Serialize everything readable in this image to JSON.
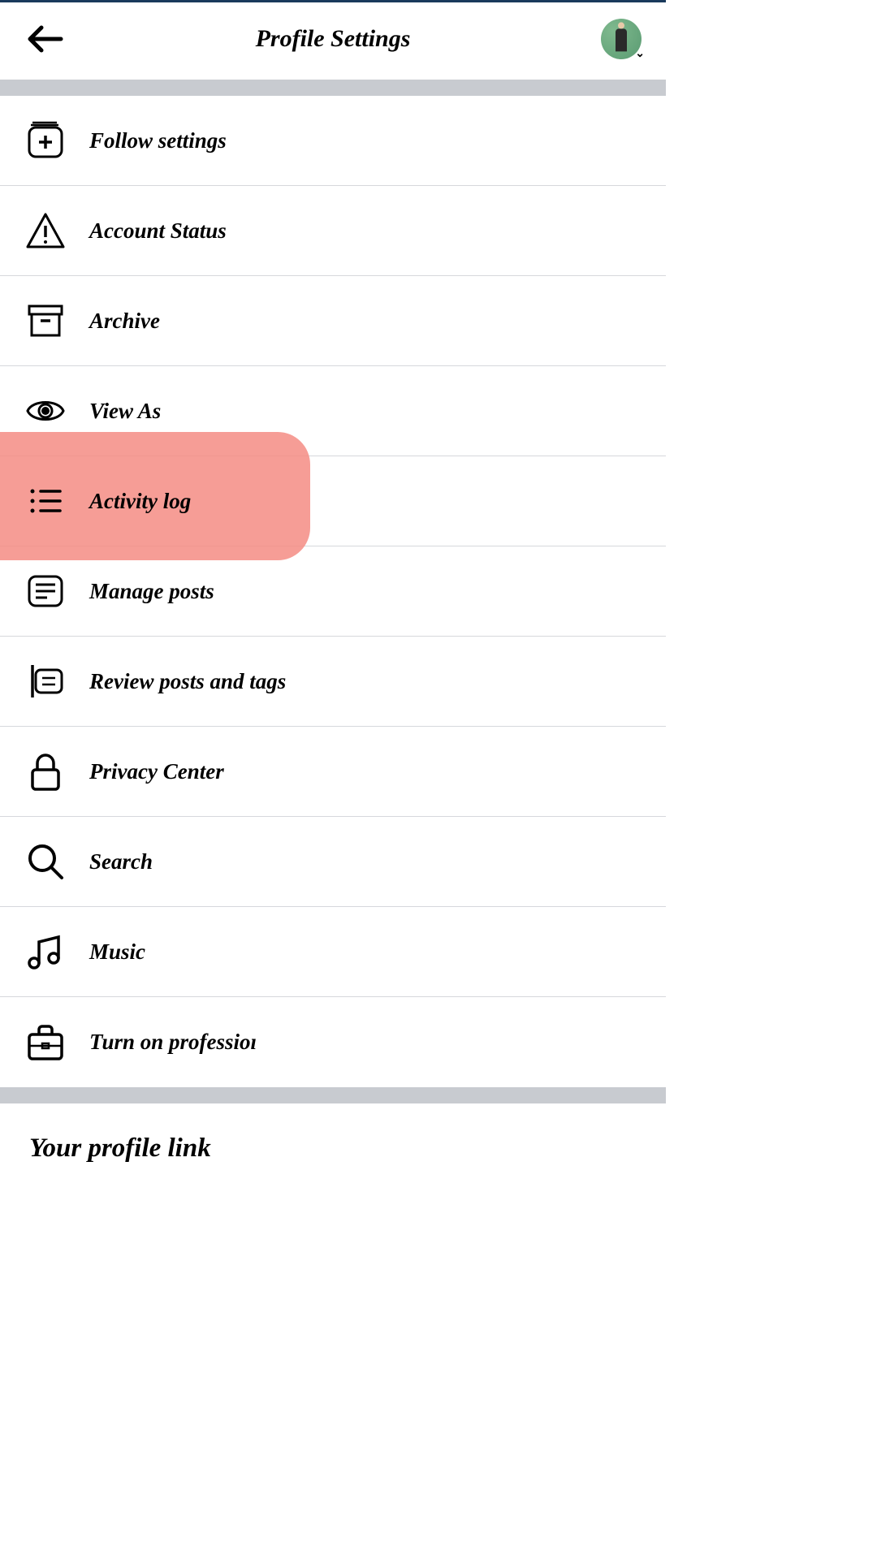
{
  "header": {
    "title": "Profile Settings"
  },
  "menu": [
    {
      "icon": "follow-plus-icon",
      "label": "Follow settings",
      "highlighted": false
    },
    {
      "icon": "warning-icon",
      "label": "Account Status",
      "highlighted": false
    },
    {
      "icon": "archive-box-icon",
      "label": "Archive",
      "highlighted": false
    },
    {
      "icon": "eye-icon",
      "label": "View As",
      "highlighted": false
    },
    {
      "icon": "list-icon",
      "label": "Activity log",
      "highlighted": true
    },
    {
      "icon": "manage-posts-icon",
      "label": "Manage posts",
      "highlighted": false
    },
    {
      "icon": "review-tags-icon",
      "label": "Review posts and tags",
      "highlighted": false
    },
    {
      "icon": "lock-icon",
      "label": "Privacy Center",
      "highlighted": false
    },
    {
      "icon": "search-icon",
      "label": "Search",
      "highlighted": false
    },
    {
      "icon": "music-icon",
      "label": "Music",
      "highlighted": false
    },
    {
      "icon": "briefcase-icon",
      "label": "Turn on professioı",
      "highlighted": false
    }
  ],
  "section": {
    "title": "Your profile link"
  }
}
